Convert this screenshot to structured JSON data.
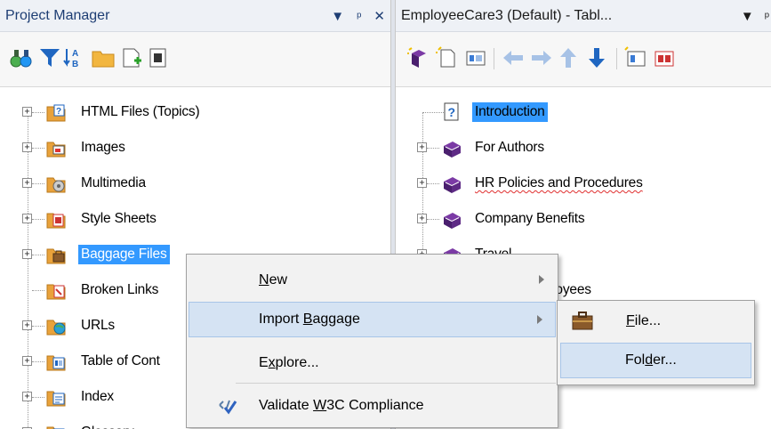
{
  "left_pane": {
    "title": "Project Manager",
    "controls": [
      "▾",
      "ᵖ",
      "✕"
    ],
    "toolbar_icons": [
      "binoculars-icon",
      "filter-icon",
      "sort-az-icon",
      "folder-icon",
      "new-file-icon",
      "properties-icon"
    ],
    "items": [
      {
        "label": "HTML Files (Topics)",
        "icon": "html-folder-icon",
        "expander": "+"
      },
      {
        "label": "Images",
        "icon": "images-folder-icon",
        "expander": "+"
      },
      {
        "label": "Multimedia",
        "icon": "multimedia-folder-icon",
        "expander": "+"
      },
      {
        "label": "Style Sheets",
        "icon": "stylesheet-folder-icon",
        "expander": "+"
      },
      {
        "label": "Baggage Files",
        "icon": "baggage-folder-icon",
        "expander": "+"
      },
      {
        "label": "Broken Links",
        "icon": "broken-links-folder-icon",
        "expander": ""
      },
      {
        "label": "URLs",
        "icon": "urls-folder-icon",
        "expander": "+"
      },
      {
        "label": "Table of Cont",
        "icon": "toc-folder-icon",
        "expander": "+"
      },
      {
        "label": "Index",
        "icon": "index-folder-icon",
        "expander": "+"
      },
      {
        "label": "Glossary",
        "icon": "glossary-folder-icon",
        "expander": "+"
      }
    ]
  },
  "right_pane": {
    "title": "EmployeeCare3 (Default) - Tabl...",
    "controls": [
      "▾",
      "ᵖ"
    ],
    "toolbar_icons": [
      "new-book-icon",
      "new-page-icon",
      "toc-view-icon",
      "move-left-icon",
      "move-right-icon",
      "move-up-icon",
      "move-down-icon",
      "toc-props-icon",
      "toc-book-icon"
    ],
    "items": [
      {
        "label": "Introduction",
        "icon": "help-page-icon",
        "expander": ""
      },
      {
        "label": "For Authors",
        "icon": "book-icon",
        "expander": "+"
      },
      {
        "label": "HR Policies and Procedures",
        "icon": "book-icon",
        "expander": "+"
      },
      {
        "label": "Company Benefits",
        "icon": "book-icon",
        "expander": "+"
      },
      {
        "label": "Travel",
        "icon": "book-icon",
        "expander": "+"
      },
      {
        "label": "Retiring Employees",
        "icon": "book-icon",
        "expander": "+"
      }
    ]
  },
  "context_menu": {
    "items": [
      {
        "label": "New",
        "mnemonic_index": 0,
        "submenu": true
      },
      {
        "label": "Import Baggage",
        "mnemonic_index": 7,
        "submenu": true
      },
      {
        "label": "Explore...",
        "mnemonic_index": 1,
        "submenu": false
      },
      {
        "label": "Validate W3C Compliance",
        "mnemonic_index": 9,
        "submenu": false
      }
    ]
  },
  "submenu": {
    "items": [
      {
        "label": "File...",
        "mnemonic_index": 0
      },
      {
        "label": "Folder...",
        "mnemonic_index": 3
      }
    ]
  },
  "colors": {
    "selection": "#3399ff",
    "menu_hover": "#d5e3f3",
    "title_text": "#1e3e74",
    "book": "#6b2d8f",
    "folder": "#e9a23b"
  }
}
